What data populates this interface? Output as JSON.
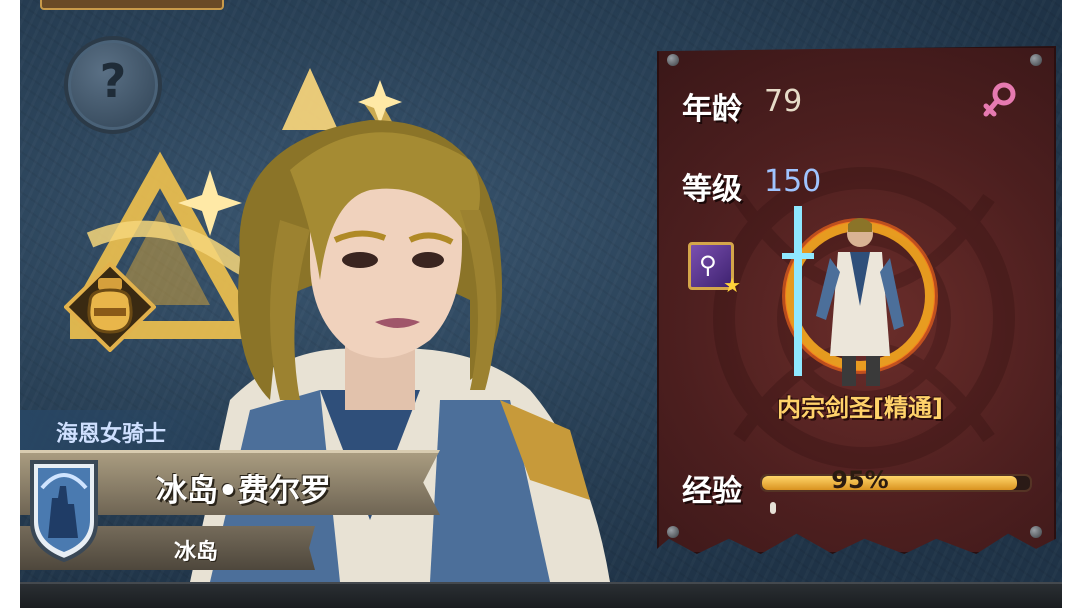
{
  "character": {
    "title": "海恩女骑士",
    "name": "冰岛•费尔罗",
    "origin": "冰岛"
  },
  "stats": {
    "age_label": "年龄",
    "age_value": "79",
    "level_label": "等级",
    "level_value": "150",
    "class_name": "内宗剑圣[精通]",
    "exp_label": "经验",
    "exp_text": "95%",
    "exp_fraction": 0.95
  },
  "icons": {
    "help": "question-mark-icon",
    "gender": "female-symbol-icon",
    "skill": "wand-skill-icon",
    "potion": "potion-icon",
    "crest": "castle-crest-icon"
  },
  "colors": {
    "panel": "#4d1f1f",
    "level": "#9fc4ff",
    "class_name": "#ffd26a",
    "exp_bar": "#f0b53a",
    "gender": "#e67ab0"
  }
}
